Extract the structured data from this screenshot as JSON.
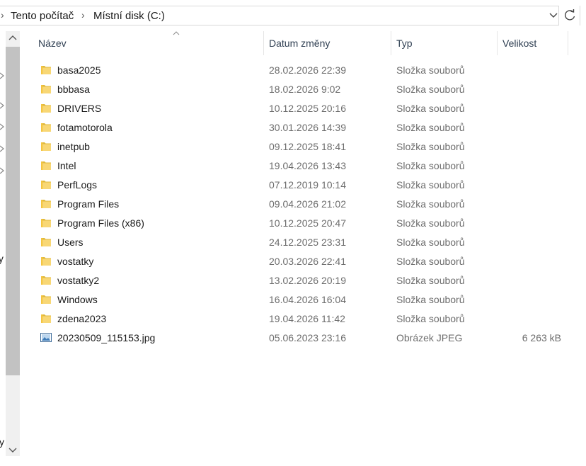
{
  "address": {
    "crumbs": [
      "Tento počítač",
      "Místní disk (C:)"
    ]
  },
  "nav_fragments": [
    "ty",
    "y"
  ],
  "columns": {
    "name": "Název",
    "date": "Datum změny",
    "type": "Typ",
    "size": "Velikost"
  },
  "files": [
    {
      "name": "basa2025",
      "date": "28.02.2026 22:39",
      "type": "Složka souborů",
      "size": "",
      "icon": "folder-icon"
    },
    {
      "name": "bbbasa",
      "date": "18.02.2026 9:02",
      "type": "Složka souborů",
      "size": "",
      "icon": "folder-icon"
    },
    {
      "name": "DRIVERS",
      "date": "10.12.2025 20:16",
      "type": "Složka souborů",
      "size": "",
      "icon": "folder-icon"
    },
    {
      "name": "fotamotorola",
      "date": "30.01.2026 14:39",
      "type": "Složka souborů",
      "size": "",
      "icon": "folder-icon"
    },
    {
      "name": "inetpub",
      "date": "09.12.2025 18:41",
      "type": "Složka souborů",
      "size": "",
      "icon": "folder-icon"
    },
    {
      "name": "Intel",
      "date": "19.04.2026 13:43",
      "type": "Složka souborů",
      "size": "",
      "icon": "folder-icon"
    },
    {
      "name": "PerfLogs",
      "date": "07.12.2019 10:14",
      "type": "Složka souborů",
      "size": "",
      "icon": "folder-icon"
    },
    {
      "name": "Program Files",
      "date": "09.04.2026 21:02",
      "type": "Složka souborů",
      "size": "",
      "icon": "folder-icon"
    },
    {
      "name": "Program Files (x86)",
      "date": "10.12.2025 20:47",
      "type": "Složka souborů",
      "size": "",
      "icon": "folder-icon"
    },
    {
      "name": "Users",
      "date": "24.12.2025 23:31",
      "type": "Složka souborů",
      "size": "",
      "icon": "folder-icon"
    },
    {
      "name": "vostatky",
      "date": "20.03.2026 22:41",
      "type": "Složka souborů",
      "size": "",
      "icon": "folder-icon"
    },
    {
      "name": "vostatky2",
      "date": "13.02.2026 20:19",
      "type": "Složka souborů",
      "size": "",
      "icon": "folder-icon"
    },
    {
      "name": "Windows",
      "date": "16.04.2026 16:04",
      "type": "Složka souborů",
      "size": "",
      "icon": "folder-icon"
    },
    {
      "name": "zdena2023",
      "date": "19.04.2026 11:42",
      "type": "Složka souborů",
      "size": "",
      "icon": "folder-icon"
    },
    {
      "name": "20230509_115153.jpg",
      "date": "05.06.2023 23:16",
      "type": "Obrázek JPEG",
      "size": "6 263 kB",
      "icon": "image-file-icon"
    }
  ],
  "colors": {
    "folder": "#f8d775",
    "folder_dark": "#e0b93c",
    "header_text": "#2f3f52",
    "meta_text": "#6d6d6d",
    "scroll_thumb": "#c2c2c2"
  }
}
